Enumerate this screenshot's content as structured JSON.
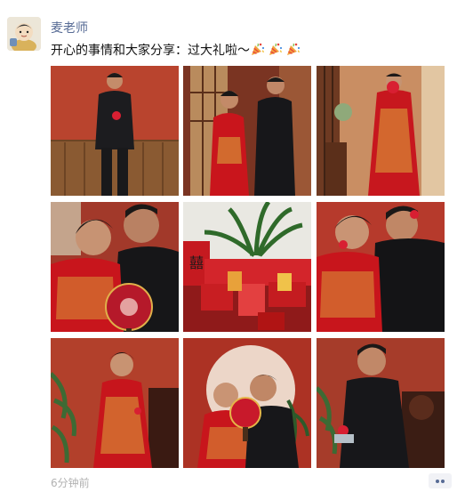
{
  "post": {
    "author": "麦老师",
    "text": "开心的事情和大家分享：过大礼啦～",
    "emoji": [
      "party-popper-icon",
      "party-popper-icon",
      "party-popper-icon"
    ],
    "time": "6分钟前",
    "photos": [
      "wedding-photo-1",
      "wedding-photo-2",
      "wedding-photo-3",
      "wedding-photo-4",
      "wedding-photo-5",
      "wedding-photo-6",
      "wedding-photo-7",
      "wedding-photo-8",
      "wedding-photo-9"
    ]
  },
  "colors": {
    "author": "#576b95",
    "timestamp": "#b2b2b2",
    "more_bg": "#f1f2f6",
    "backdrop_red": "#b8402c",
    "qun_gua_red": "#c8151c"
  }
}
